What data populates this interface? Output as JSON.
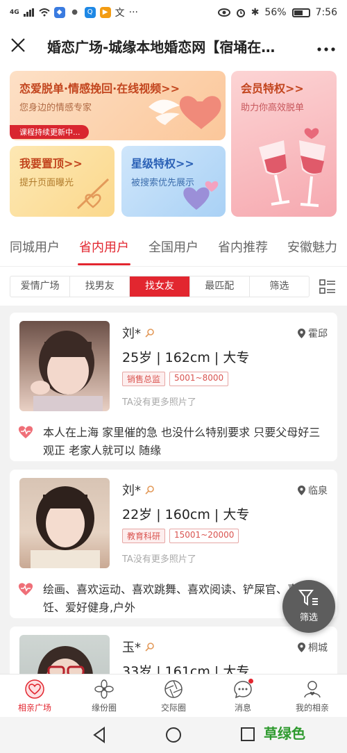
{
  "status_bar": {
    "network": "4G",
    "battery": "56%",
    "time": "7:56"
  },
  "titlebar": {
    "title": "婚恋广场-城缘本地婚恋网【宿埇在…"
  },
  "banners": {
    "emotion": {
      "title": "恋爱脱单·情感挽回·在线视频>>",
      "subtitle": "您身边的情感专家",
      "ribbon": "课程持续更新中..."
    },
    "vip": {
      "title": "会员特权>>",
      "subtitle": "助力你高效脱单"
    },
    "top": {
      "title": "我要置顶>>",
      "subtitle": "提升页面曝光"
    },
    "star": {
      "title": "星级特权>>",
      "subtitle": "被搜索优先展示"
    }
  },
  "tabs": [
    "同城用户",
    "省内用户",
    "全国用户",
    "省内推荐",
    "安徽魅力"
  ],
  "active_tab": 1,
  "filters": [
    "爱情广场",
    "找男友",
    "找女友",
    "最匹配",
    "筛选"
  ],
  "active_filter": 2,
  "profiles": [
    {
      "name": "刘*",
      "location": "霍邱",
      "stats": "25岁 | 162cm | 大专",
      "job": "销售总监",
      "income": "5001~8000",
      "photo_note": "TA没有更多照片了",
      "bio": "本人在上海 家里催的急 也没什么特别要求 只要父母好三观正 老家人就可以 随缘"
    },
    {
      "name": "刘*",
      "location": "临泉",
      "stats": "22岁 | 160cm | 大专",
      "job": "教育科研",
      "income": "15001~20000",
      "photo_note": "TA没有更多照片了",
      "bio": "绘画、喜欢运动、喜欢跳舞、喜欢阅读、铲屎官、喜欢烹饪、爱好健身,户外"
    },
    {
      "name": "玉*",
      "location": "桐城",
      "stats": "33岁 | 161cm | 大专"
    }
  ],
  "fab_label": "筛选",
  "bottom_nav": [
    "相亲广场",
    "缘份圈",
    "交际圈",
    "消息",
    "我的相亲"
  ],
  "watermark": "草绿色",
  "colors": {
    "accent": "#e2262f",
    "fab": "#5d5d5d"
  }
}
